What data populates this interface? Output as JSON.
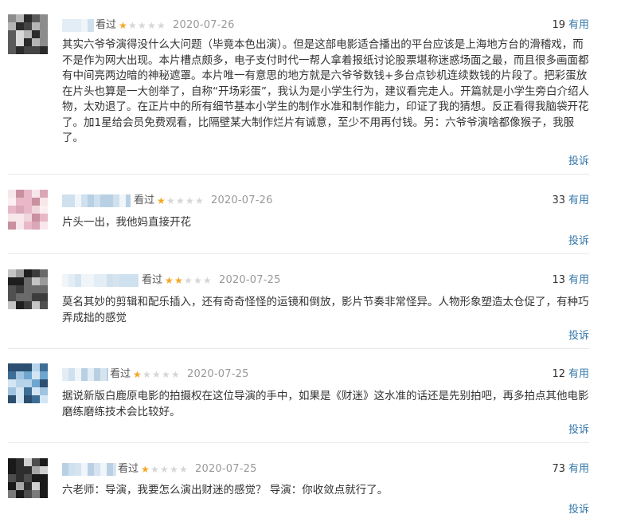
{
  "colors": {
    "link": "#3377aa",
    "star_on": "#f5a623",
    "star_off": "#d6d6d6",
    "date": "#999999",
    "text": "#333333"
  },
  "reviews": [
    {
      "watched_label": "看过",
      "rating": 1,
      "max_rating": 5,
      "date": "2020-07-26",
      "useful_count": "19",
      "useful_label": "有用",
      "content": "其实六爷爷演得没什么大问题（毕竟本色出演）。但是这部电影适合播出的平台应该是上海地方台的滑稽戏，而不是作为网大出现。本片槽点颇多，电子支付时代一帮人拿着报纸讨论股票堪称迷惑场面之最，而且很多画面都有中间亮两边暗的神秘遮罩。本片唯一有意思的地方就是六爷爷数钱+多台点钞机连续数钱的片段了。把彩蛋放在片头也算是一大创举了，自称“开场彩蛋”，我认为是小学生行为，建议看完走人。开篇就是小学生旁白介绍人物，太劝退了。在正片中的所有细节基本小学生的制作水准和制作能力，印证了我的猜想。反正看得我脑袋开花了。加1星给会员免费观看，比隔壁某大制作烂片有诚意，至少不用再付钱。另：六爷爷演啥都像猴子，我服了。",
      "report_label": "投诉"
    },
    {
      "watched_label": "看过",
      "rating": 1,
      "max_rating": 5,
      "date": "2020-07-26",
      "useful_count": "33",
      "useful_label": "有用",
      "content": "片头一出，我他妈直接开花",
      "report_label": "投诉"
    },
    {
      "watched_label": "看过",
      "rating": 2,
      "max_rating": 5,
      "date": "2020-07-25",
      "useful_count": "13",
      "useful_label": "有用",
      "content": "莫名其妙的剪辑和配乐插入，还有奇奇怪怪的运镜和倒放，影片节奏非常怪异。人物形象塑造太仓促了，有种巧弄成拙的感觉",
      "report_label": "投诉"
    },
    {
      "watched_label": "看过",
      "rating": 1,
      "max_rating": 5,
      "date": "2020-07-25",
      "useful_count": "12",
      "useful_label": "有用",
      "content": "据说新版白鹿原电影的拍摄权在这位导演的手中，如果是《财迷》这水准的话还是先别拍吧，再多拍点其他电影磨练磨练技术会比较好。",
      "report_label": "投诉"
    },
    {
      "watched_label": "看过",
      "rating": 1,
      "max_rating": 5,
      "date": "2020-07-25",
      "useful_count": "73",
      "useful_label": "有用",
      "content": "六老师：导演，我要怎么演出财迷的感觉？ 导演：你收敛点就行了。",
      "report_label": "投诉"
    }
  ]
}
